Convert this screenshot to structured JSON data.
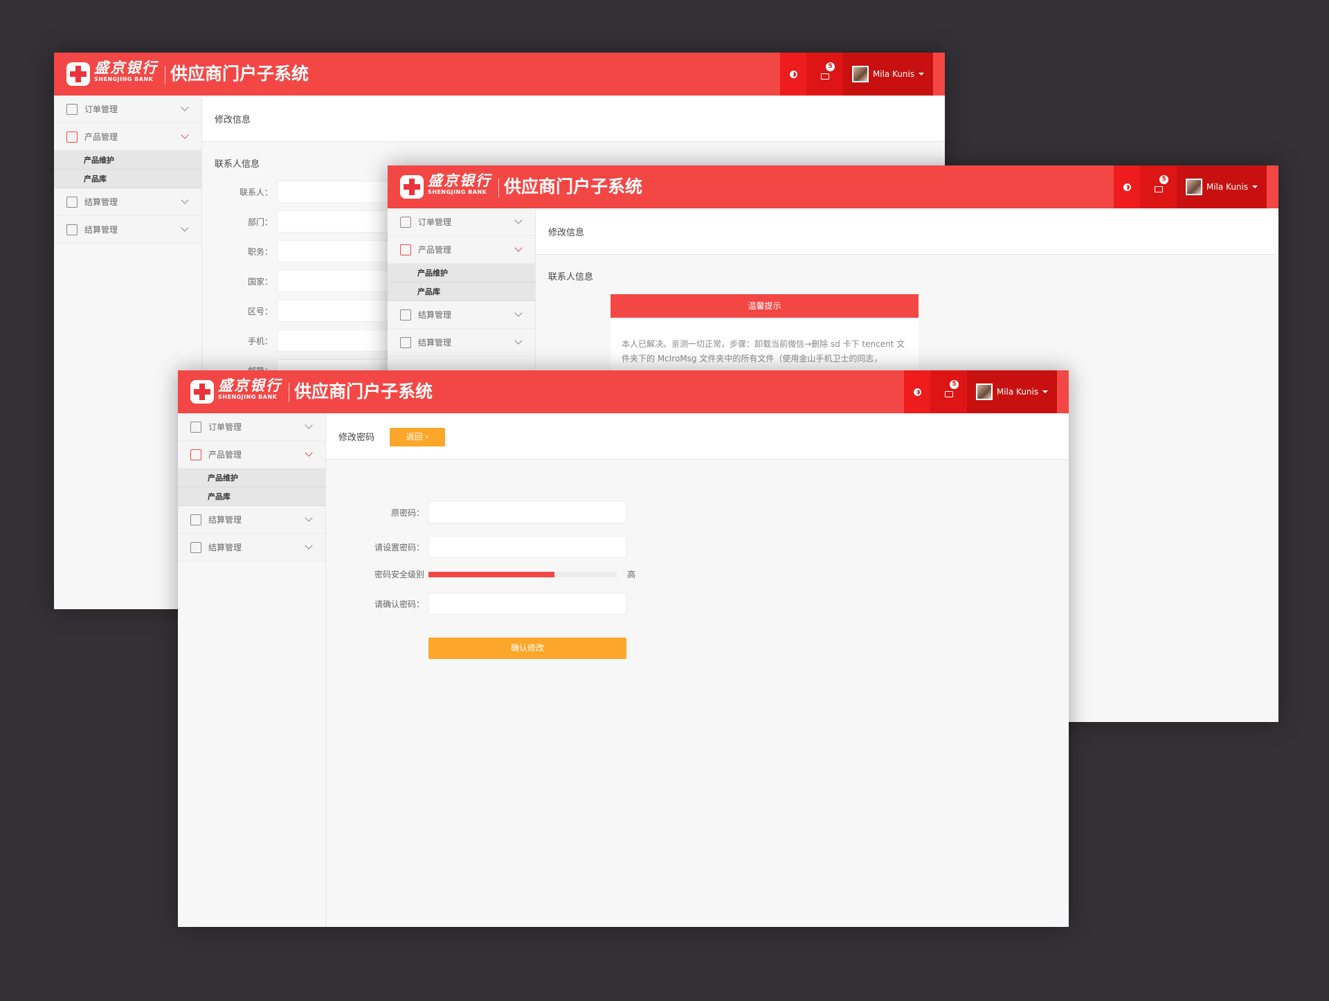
{
  "header": {
    "bank_cn": "盛京银行",
    "bank_en": "SHENGJING BANK",
    "system_title": "供应商门户子系统",
    "mail_count": "5",
    "user_name": "Mila Kunis"
  },
  "sidebar": {
    "items": [
      {
        "label": "订单管理",
        "icon": "order-icon"
      },
      {
        "label": "产品管理",
        "icon": "gift-icon",
        "open": true,
        "children": [
          "产品维护",
          "产品库"
        ]
      },
      {
        "label": "结算管理",
        "icon": "calculator-icon"
      },
      {
        "label": "结算管理",
        "icon": "invoice-icon"
      }
    ]
  },
  "window1": {
    "page_title": "修改信息",
    "section_title": "联系人信息",
    "fields": [
      "联系人：",
      "部门：",
      "职务：",
      "国家：",
      "区号：",
      "手机：",
      "邮箱："
    ]
  },
  "window2": {
    "page_title": "修改信息",
    "section_title": "联系人信息",
    "modal": {
      "title": "温馨提示",
      "body": "本人已解决。亲测一切正常，步骤：卸载当前微信→删除 sd 卡下 tencent 文件夹下的 McIroMsg 文件夹中的所有文件（使用金山手机卫士的同志，"
    }
  },
  "window3": {
    "page_title": "修改密码",
    "back_label": "返回 ›",
    "fields": {
      "old": "原密码：",
      "new": "请设置密码：",
      "strength": "密码安全级别",
      "strength_level": "高",
      "confirm": "请确认密码："
    },
    "strength_value": 0.67,
    "submit_label": "确认修改"
  },
  "colors": {
    "brand_red": "#f24745",
    "accent_orange": "#fca72a",
    "background": "#333135"
  }
}
